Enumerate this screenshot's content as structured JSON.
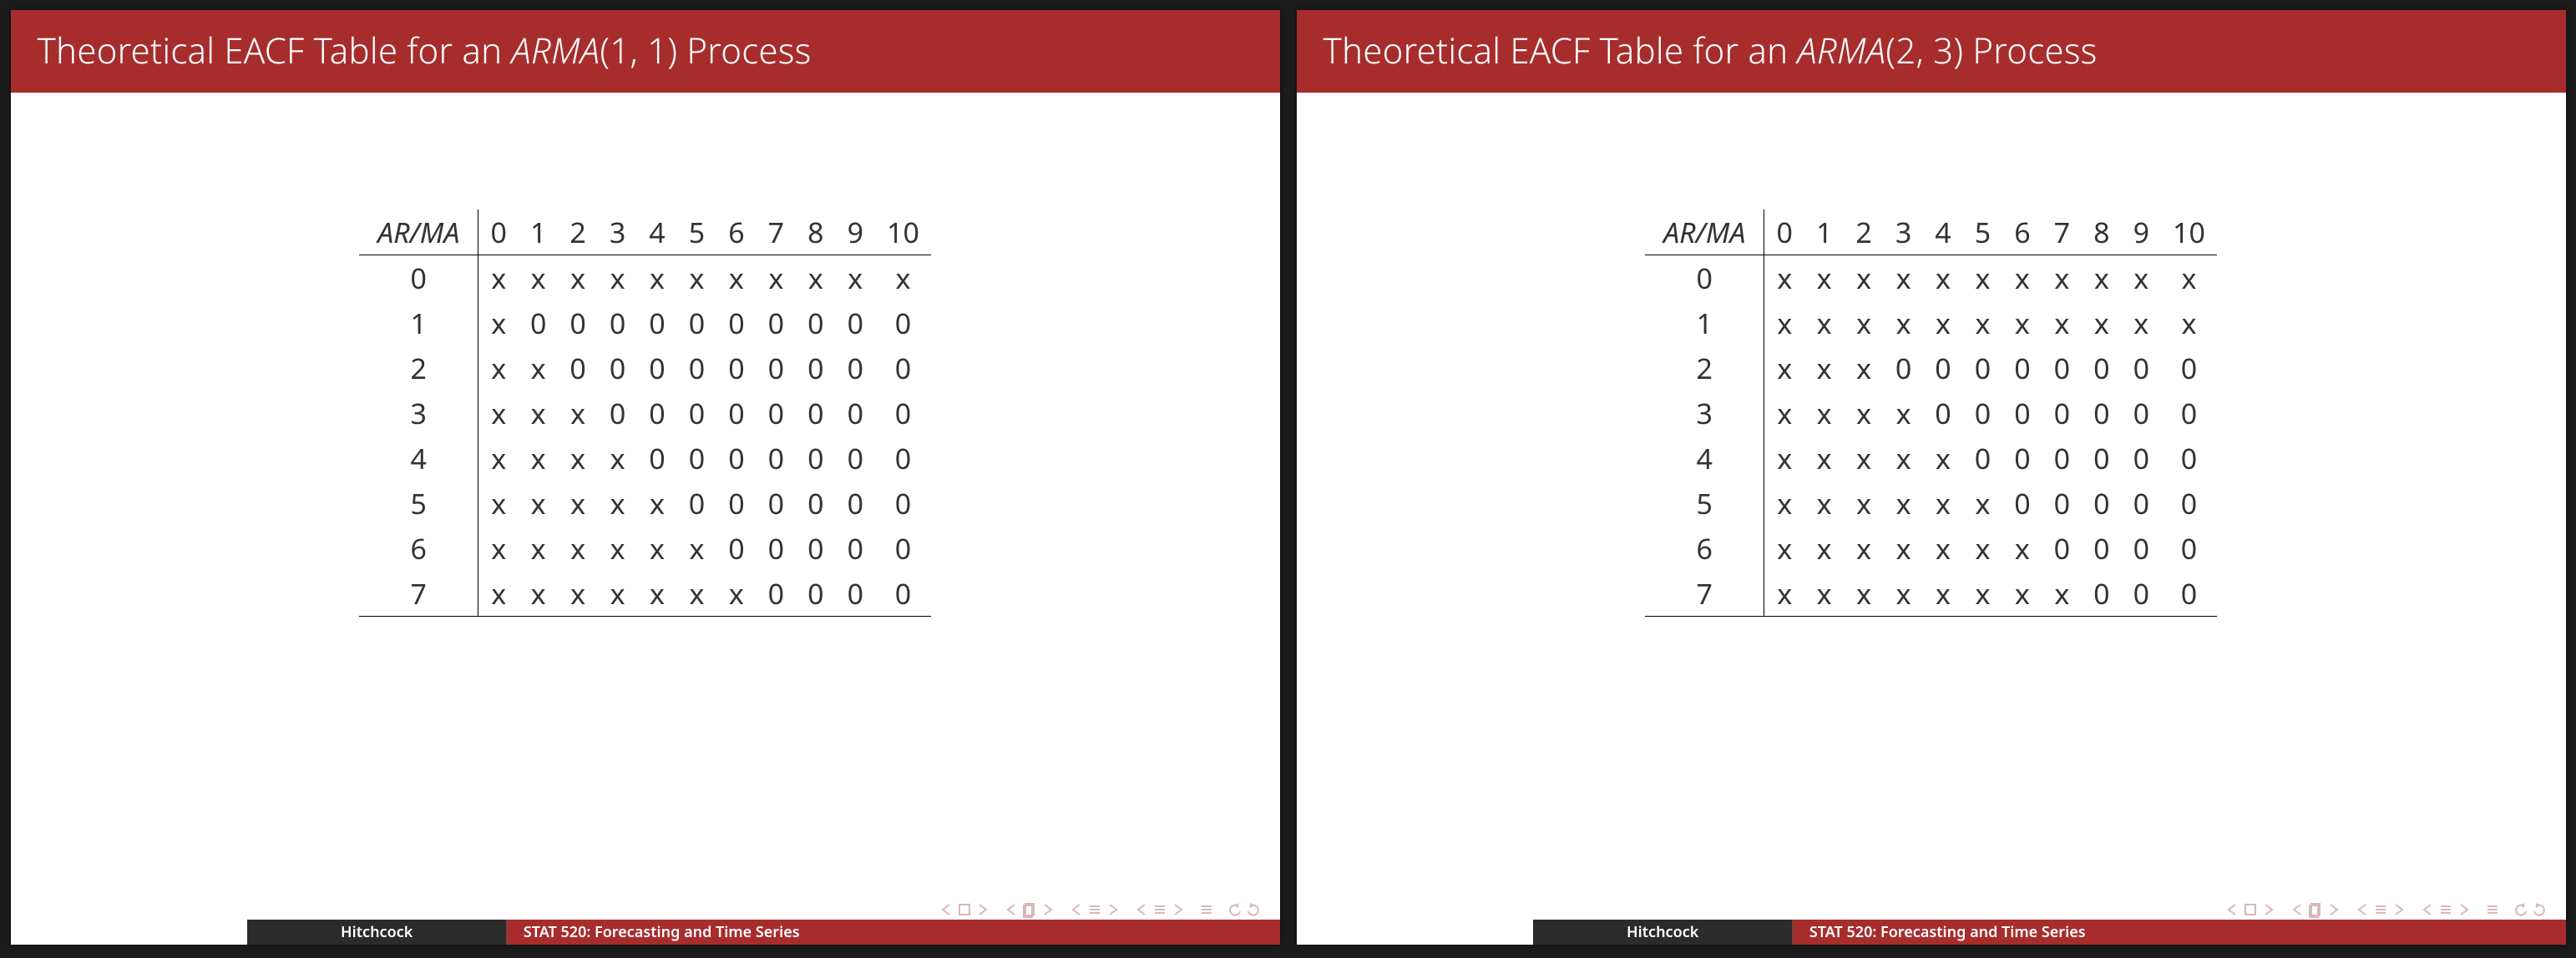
{
  "slides": [
    {
      "title_prefix": "Theoretical EACF Table for an ",
      "title_model": "ARMA",
      "title_params": "(1, 1)",
      "title_suffix": " Process",
      "corner": "AR/MA",
      "ma_headers": [
        "0",
        "1",
        "2",
        "3",
        "4",
        "5",
        "6",
        "7",
        "8",
        "9",
        "10"
      ],
      "rows": [
        {
          "ar": "0",
          "cells": [
            "x",
            "x",
            "x",
            "x",
            "x",
            "x",
            "x",
            "x",
            "x",
            "x",
            "x"
          ]
        },
        {
          "ar": "1",
          "cells": [
            "x",
            "0",
            "0",
            "0",
            "0",
            "0",
            "0",
            "0",
            "0",
            "0",
            "0"
          ]
        },
        {
          "ar": "2",
          "cells": [
            "x",
            "x",
            "0",
            "0",
            "0",
            "0",
            "0",
            "0",
            "0",
            "0",
            "0"
          ]
        },
        {
          "ar": "3",
          "cells": [
            "x",
            "x",
            "x",
            "0",
            "0",
            "0",
            "0",
            "0",
            "0",
            "0",
            "0"
          ]
        },
        {
          "ar": "4",
          "cells": [
            "x",
            "x",
            "x",
            "x",
            "0",
            "0",
            "0",
            "0",
            "0",
            "0",
            "0"
          ]
        },
        {
          "ar": "5",
          "cells": [
            "x",
            "x",
            "x",
            "x",
            "x",
            "0",
            "0",
            "0",
            "0",
            "0",
            "0"
          ]
        },
        {
          "ar": "6",
          "cells": [
            "x",
            "x",
            "x",
            "x",
            "x",
            "x",
            "0",
            "0",
            "0",
            "0",
            "0"
          ]
        },
        {
          "ar": "7",
          "cells": [
            "x",
            "x",
            "x",
            "x",
            "x",
            "x",
            "x",
            "0",
            "0",
            "0",
            "0"
          ]
        }
      ],
      "footer_author": "Hitchcock",
      "footer_course": "STAT 520: Forecasting and Time Series"
    },
    {
      "title_prefix": "Theoretical EACF Table for an ",
      "title_model": "ARMA",
      "title_params": "(2, 3)",
      "title_suffix": " Process",
      "corner": "AR/MA",
      "ma_headers": [
        "0",
        "1",
        "2",
        "3",
        "4",
        "5",
        "6",
        "7",
        "8",
        "9",
        "10"
      ],
      "rows": [
        {
          "ar": "0",
          "cells": [
            "x",
            "x",
            "x",
            "x",
            "x",
            "x",
            "x",
            "x",
            "x",
            "x",
            "x"
          ]
        },
        {
          "ar": "1",
          "cells": [
            "x",
            "x",
            "x",
            "x",
            "x",
            "x",
            "x",
            "x",
            "x",
            "x",
            "x"
          ]
        },
        {
          "ar": "2",
          "cells": [
            "x",
            "x",
            "x",
            "0",
            "0",
            "0",
            "0",
            "0",
            "0",
            "0",
            "0"
          ]
        },
        {
          "ar": "3",
          "cells": [
            "x",
            "x",
            "x",
            "x",
            "0",
            "0",
            "0",
            "0",
            "0",
            "0",
            "0"
          ]
        },
        {
          "ar": "4",
          "cells": [
            "x",
            "x",
            "x",
            "x",
            "x",
            "0",
            "0",
            "0",
            "0",
            "0",
            "0"
          ]
        },
        {
          "ar": "5",
          "cells": [
            "x",
            "x",
            "x",
            "x",
            "x",
            "x",
            "0",
            "0",
            "0",
            "0",
            "0"
          ]
        },
        {
          "ar": "6",
          "cells": [
            "x",
            "x",
            "x",
            "x",
            "x",
            "x",
            "x",
            "0",
            "0",
            "0",
            "0"
          ]
        },
        {
          "ar": "7",
          "cells": [
            "x",
            "x",
            "x",
            "x",
            "x",
            "x",
            "x",
            "x",
            "0",
            "0",
            "0"
          ]
        }
      ],
      "footer_author": "Hitchcock",
      "footer_course": "STAT 520: Forecasting and Time Series"
    }
  ]
}
